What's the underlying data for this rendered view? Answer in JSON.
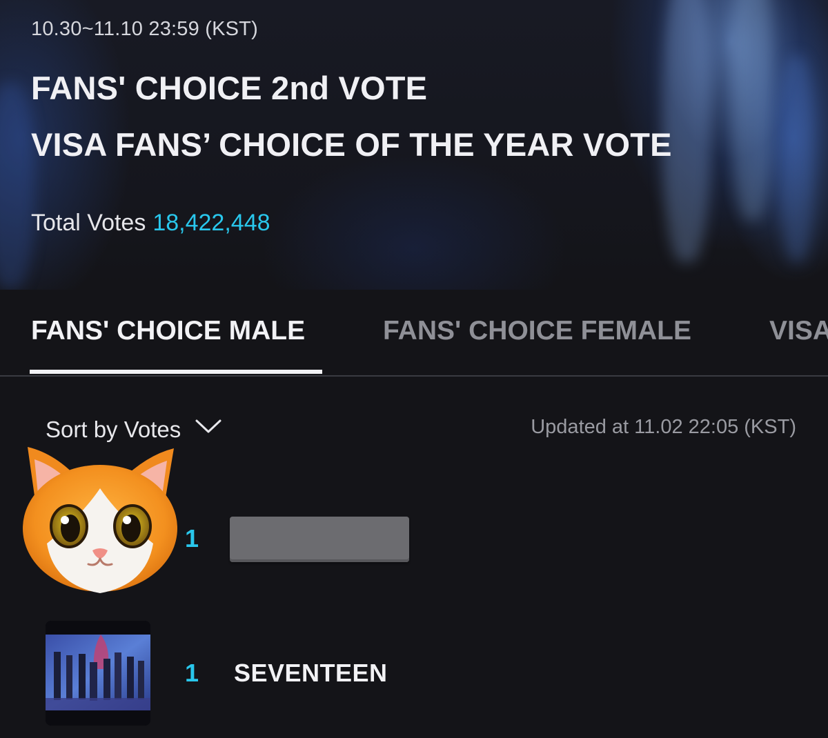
{
  "header": {
    "date_range": "10.30~11.10 23:59 (KST)",
    "title_line_1": "FANS' CHOICE 2nd VOTE",
    "title_line_2": "VISA FANS’ CHOICE OF THE YEAR VOTE",
    "total_votes_label": "Total Votes",
    "total_votes_value": "18,422,448"
  },
  "tabs": [
    {
      "label": "FANS' CHOICE MALE",
      "active": true
    },
    {
      "label": "FANS' CHOICE FEMALE",
      "active": false
    },
    {
      "label": "VISA",
      "active": false
    }
  ],
  "sort": {
    "label": "Sort by Votes",
    "icon": "chevron-down-icon"
  },
  "updated_text": "Updated at 11.02 22:05 (KST)",
  "ranking": [
    {
      "rank": "1",
      "name": "",
      "avatar": "cat-emoji-avatar",
      "name_redacted": true
    },
    {
      "rank": "1",
      "name": "SEVENTEEN",
      "avatar": "group-photo-thumbnail"
    }
  ],
  "colors": {
    "accent": "#29c7ec",
    "background": "#141418",
    "active_tab": "#f2f2f5",
    "inactive_tab": "#8f9097"
  }
}
